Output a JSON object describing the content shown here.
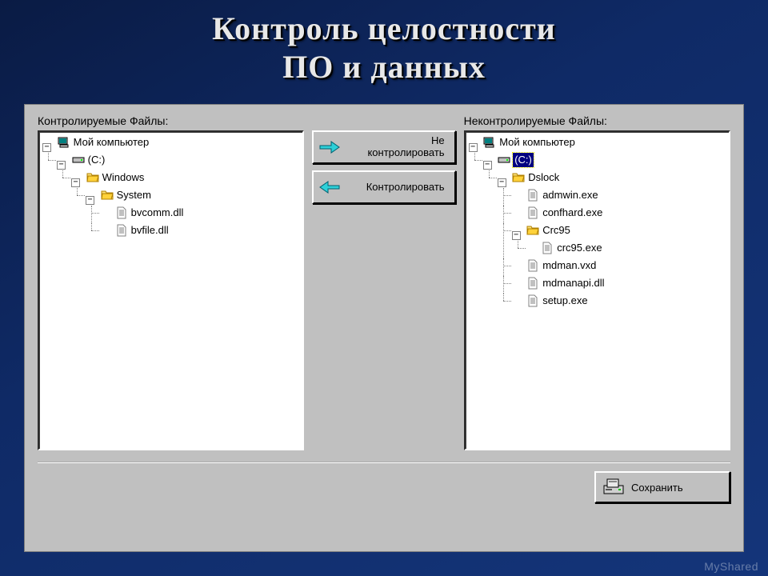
{
  "slide": {
    "title_line1": "Контроль целостности",
    "title_line2": "ПО и данных"
  },
  "labels": {
    "controlled": "Контролируемые Файлы:",
    "uncontrolled": "Неконтролируемые Файлы:"
  },
  "buttons": {
    "to_uncontrolled_line1": "Не",
    "to_uncontrolled_line2": "контролировать",
    "to_controlled": "Контролировать",
    "save": "Сохранить"
  },
  "trees": {
    "controlled": {
      "root": "Мой компьютер",
      "drive": "(C:)",
      "folders": [
        {
          "name": "Windows",
          "children": [
            {
              "name": "System",
              "files": [
                "bvcomm.dll",
                "bvfile.dll"
              ]
            }
          ]
        }
      ]
    },
    "uncontrolled": {
      "root": "Мой компьютер",
      "drive": "(C:)",
      "drive_selected": true,
      "folders": [
        {
          "name": "Dslock",
          "files": [
            "admwin.exe",
            "confhard.exe"
          ],
          "children": [
            {
              "name": "Crc95",
              "files": [
                "crc95.exe"
              ]
            }
          ],
          "files_after_children": [
            "mdman.vxd",
            "mdmanapi.dll",
            "setup.exe"
          ]
        }
      ]
    }
  },
  "watermark": "MyShared"
}
